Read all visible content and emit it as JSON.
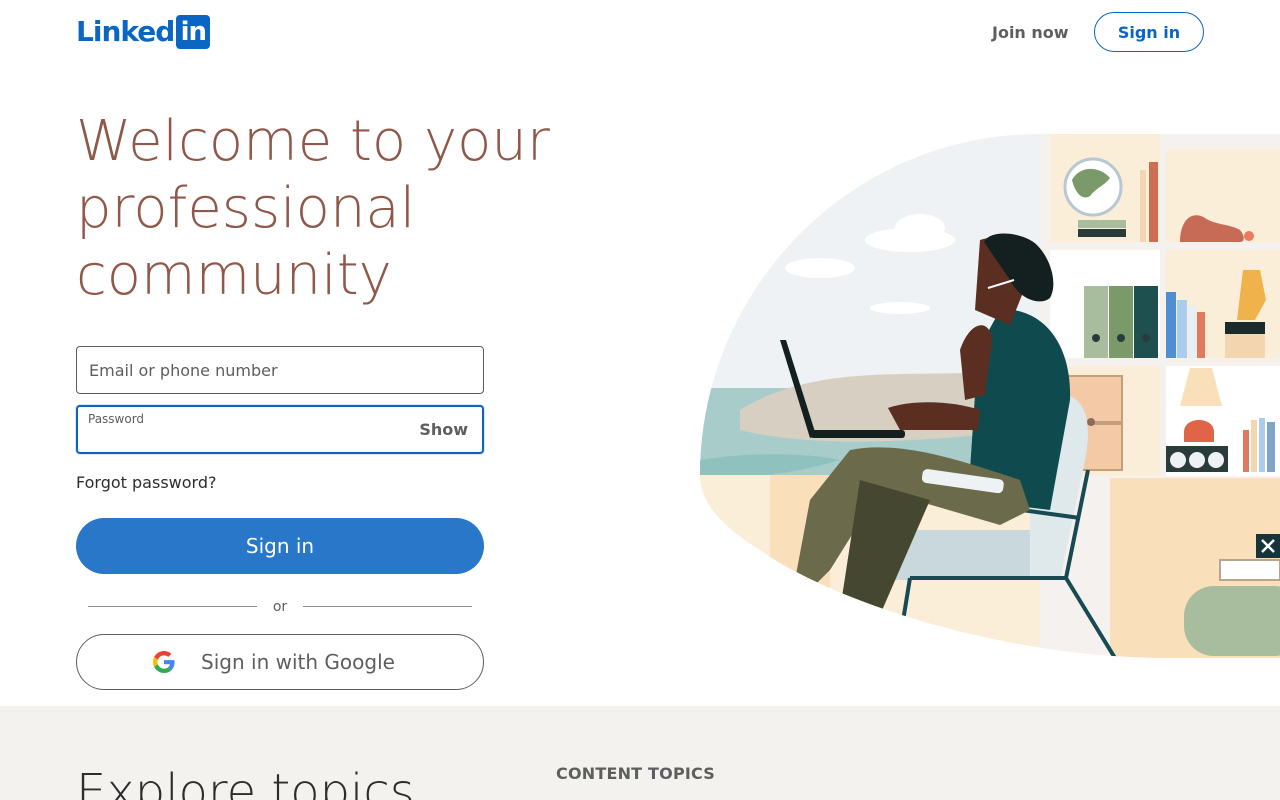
{
  "header": {
    "logo_text": "Linked",
    "logo_box_text": "in",
    "join_now_label": "Join now",
    "sign_in_label": "Sign in"
  },
  "hero": {
    "title": "Welcome to your professional community"
  },
  "form": {
    "email_placeholder": "Email or phone number",
    "password_label": "Password",
    "show_label": "Show",
    "forgot_password_label": "Forgot password?",
    "sign_in_label": "Sign in",
    "divider_text": "or",
    "google_sign_in_label": "Sign in with Google"
  },
  "bottom": {
    "explore_title": "Explore topics",
    "content_topics_label": "CONTENT TOPICS"
  },
  "colors": {
    "brand": "#0a66c2",
    "primary_button": "#2977c9",
    "hero_title": "#8f5849",
    "bottom_band": "#f3f2ef"
  },
  "icons": {
    "google": "google-g-icon",
    "close": "close-icon"
  }
}
